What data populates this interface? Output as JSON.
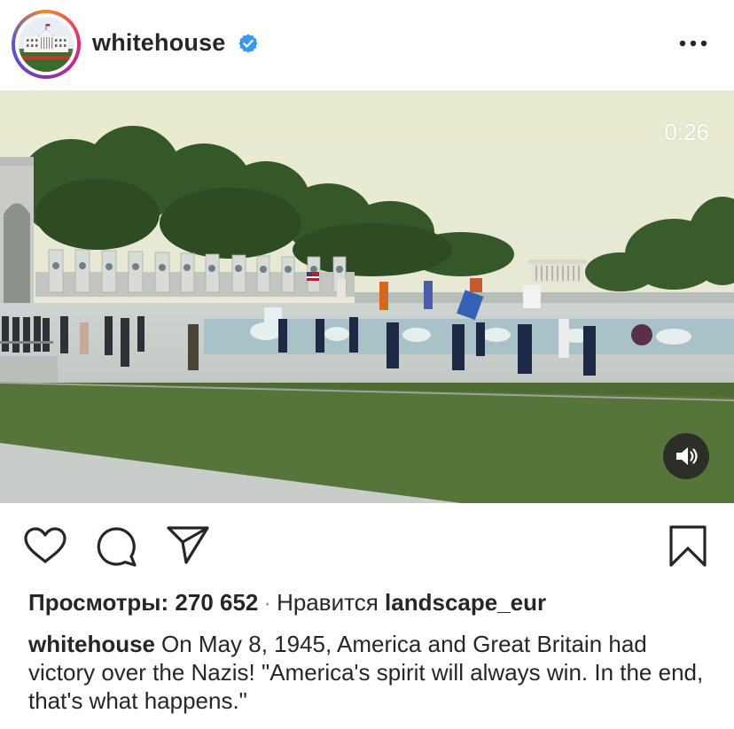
{
  "post": {
    "username": "whitehouse",
    "verified_icon": "verified-badge-icon",
    "more_icon": "more-options-icon",
    "avatar": "white-house-building-avatar"
  },
  "video": {
    "duration": "0:26",
    "sound_icon": "speaker-volume-icon"
  },
  "actions": {
    "like_icon": "heart-icon",
    "comment_icon": "comment-bubble-icon",
    "share_icon": "paper-plane-icon",
    "save_icon": "bookmark-icon"
  },
  "stats": {
    "views_label": "Просмотры: 270 652",
    "separator": "·",
    "liked_by_label": "Нравится",
    "liked_by_user": "landscape_eur"
  },
  "caption": {
    "username": "whitehouse",
    "text": "On May 8, 1945, America and Great Britain had victory over the Nazis! \"America's spirit will always win. In the end, that's what happens.\""
  },
  "colors": {
    "verified_blue": "#3897f0",
    "text": "#262626",
    "secondary": "#8e8e8e"
  }
}
